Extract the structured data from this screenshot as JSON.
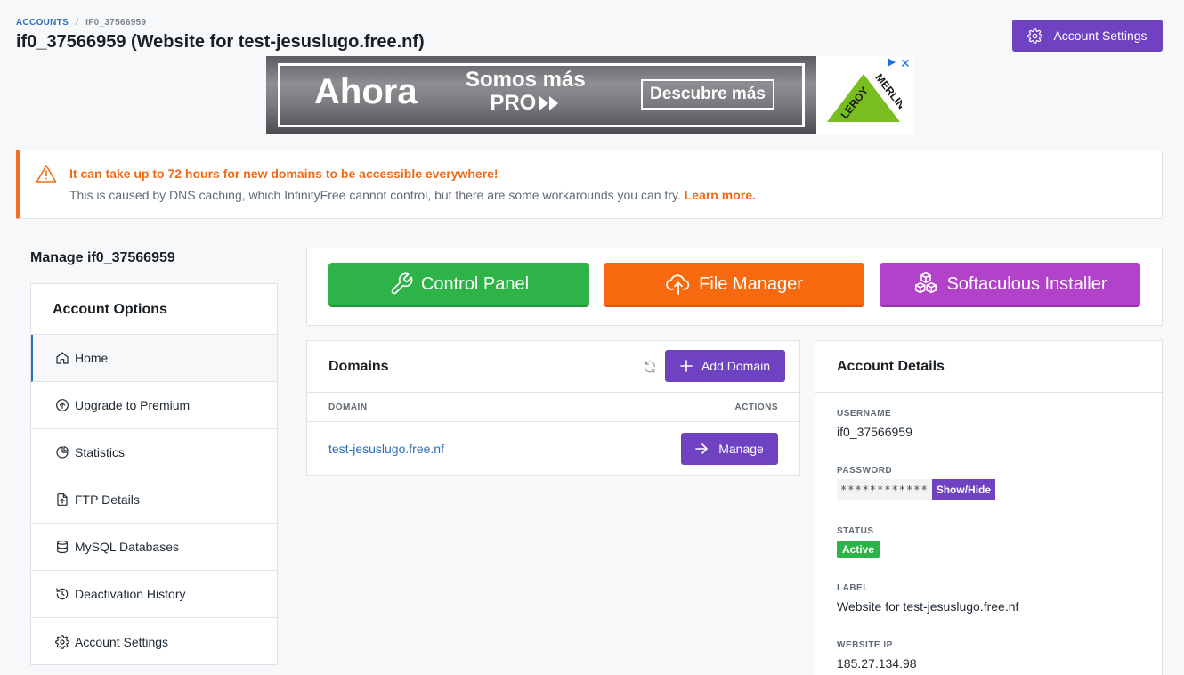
{
  "breadcrumb": {
    "accounts": "ACCOUNTS",
    "separator": "/",
    "current": "IF0_37566959"
  },
  "page_title": "if0_37566959 (Website for test-jesuslugo.free.nf)",
  "header": {
    "account_settings_label": "Account Settings"
  },
  "ad": {
    "headline": "Ahora",
    "tagline_line1": "Somos más",
    "tagline_line2": "PRO",
    "cta": "Descubre más",
    "brand_line1": "LEROY",
    "brand_line2": "MERLIN",
    "close": "✕",
    "colors": {
      "brand_green": "#78be20"
    }
  },
  "alert": {
    "title": "It can take up to 72 hours for new domains to be accessible everywhere!",
    "body": "This is caused by DNS caching, which InfinityFree cannot control, but there are some workarounds you can try.",
    "learn_more": "Learn more.",
    "icon": "warning-triangle-icon",
    "color": "#ef6a17"
  },
  "sidebar": {
    "manage_heading": "Manage if0_37566959",
    "title": "Account Options",
    "items": [
      {
        "label": "Home",
        "icon": "home-icon"
      },
      {
        "label": "Upgrade to Premium",
        "icon": "arrow-up-circle-icon"
      },
      {
        "label": "Statistics",
        "icon": "pie-chart-icon"
      },
      {
        "label": "FTP Details",
        "icon": "file-upload-icon"
      },
      {
        "label": "MySQL Databases",
        "icon": "database-icon"
      },
      {
        "label": "Deactivation History",
        "icon": "history-icon"
      },
      {
        "label": "Account Settings",
        "icon": "gear-icon"
      }
    ]
  },
  "launch": {
    "control_panel": "Control Panel",
    "file_manager": "File Manager",
    "softaculous": "Softaculous Installer",
    "colors": {
      "control_panel": "#2db348",
      "file_manager": "#f6690e",
      "softaculous": "#b142c9"
    }
  },
  "domains": {
    "title": "Domains",
    "add_label": "Add Domain",
    "columns": {
      "domain": "DOMAIN",
      "actions": "ACTIONS"
    },
    "rows": [
      {
        "domain": "test-jesuslugo.free.nf",
        "action": "Manage"
      }
    ]
  },
  "details": {
    "title": "Account Details",
    "username_label": "USERNAME",
    "username": "if0_37566959",
    "password_label": "PASSWORD",
    "password_mask": "************",
    "show_hide": "Show/Hide",
    "status_label": "STATUS",
    "status": "Active",
    "label_label": "LABEL",
    "label": "Website for test-jesuslugo.free.nf",
    "ip_label": "WEBSITE IP",
    "ip": "185.27.134.98"
  },
  "colors": {
    "accent": "#6f42c1",
    "link": "#2c6fb7"
  }
}
